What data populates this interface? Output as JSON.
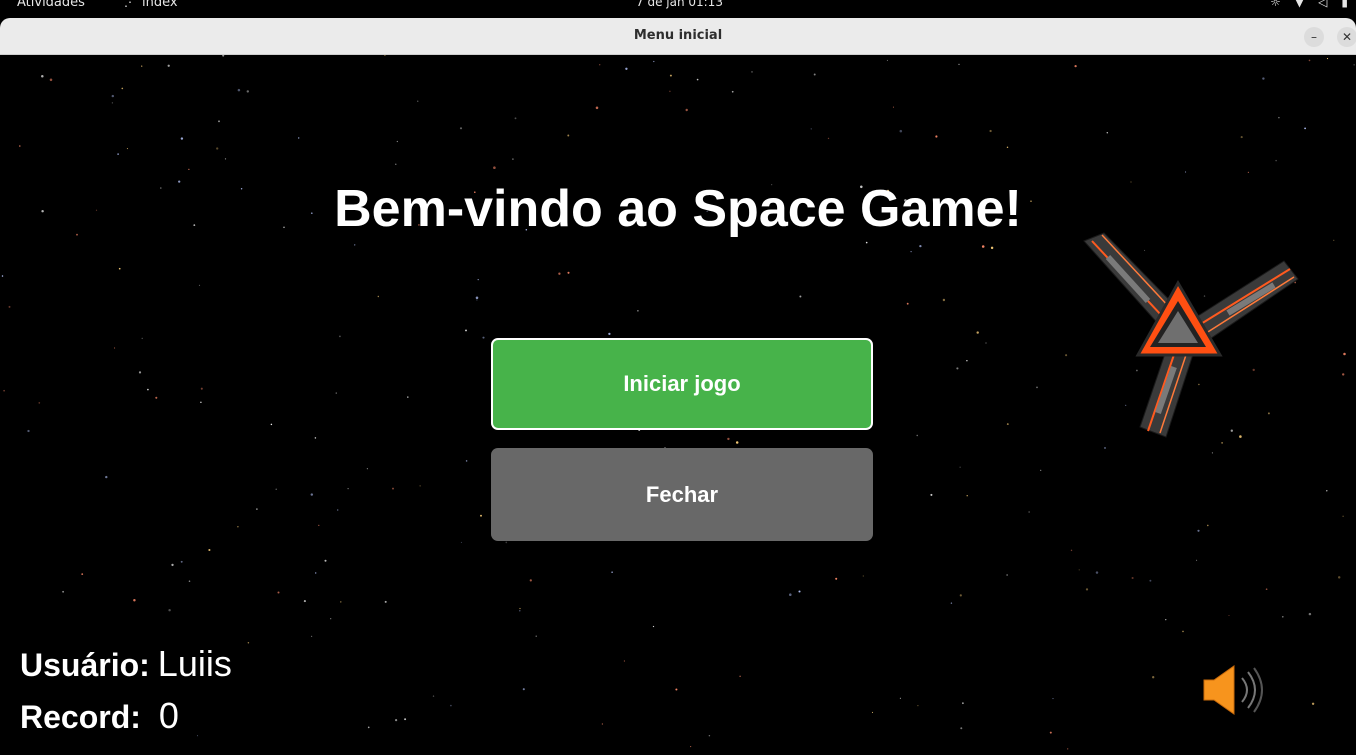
{
  "topbar": {
    "activities": "Atividades",
    "app_name": "index",
    "clock": "7 de jan  01:13"
  },
  "window": {
    "title": "Menu inicial",
    "minimize_symbol": "–",
    "close_symbol": "✕"
  },
  "game": {
    "welcome": "Bem-vindo ao Space Game!",
    "start_button": "Iniciar jogo",
    "close_button": "Fechar",
    "user_label": "Usuário:",
    "user_value": "Luiis",
    "record_label": "Record:",
    "record_value": "0"
  },
  "icons": {
    "topbar_app": "network-icon",
    "tray": [
      "brightness-icon",
      "wifi-icon",
      "volume-icon",
      "battery-icon"
    ],
    "ship": "spaceship-sprite",
    "sound": "speaker-icon"
  },
  "colors": {
    "start_button": "#47b34a",
    "close_button": "#686868",
    "speaker": "#f7941d",
    "ship_accent": "#ff5a1f"
  }
}
